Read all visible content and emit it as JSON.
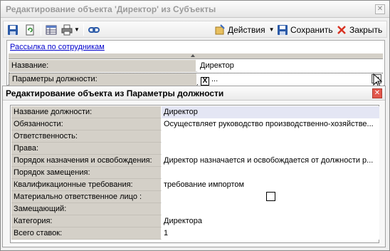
{
  "window": {
    "title": "Редактирование объекта 'Директор' из Субъекты",
    "close_glyph": "✕"
  },
  "toolbar": {
    "actions_label": "Действия",
    "save_label": "Сохранить",
    "close_label": "Закрыть"
  },
  "content": {
    "link_text": "Рассылка по сотрудникам",
    "properties": [
      {
        "label": "Название:",
        "value": "Директор"
      },
      {
        "label": "Параметры должности:",
        "value": "...",
        "x_glyph": "X",
        "button_glyph": "···"
      }
    ]
  },
  "dialog": {
    "title": "Редактирование объекта  из Параметры должности",
    "close_glyph": "✕",
    "rows": [
      {
        "label": "Название должности:",
        "value": "Директор"
      },
      {
        "label": "Обязанности:",
        "value": "Осуществляет руководство производственно-хозяйстве..."
      },
      {
        "label": "Ответственность:",
        "value": ""
      },
      {
        "label": "Права:",
        "value": ""
      },
      {
        "label": "Порядок назначения и освобождения:",
        "value": "Директор назначается и освобождается от должности  р..."
      },
      {
        "label": "Порядок замещения:",
        "value": ""
      },
      {
        "label": "Квалификационные требования:",
        "value": "требование импортом"
      },
      {
        "label": "Материально ответственное лицо :",
        "value": "",
        "checkbox": false
      },
      {
        "label": "Замещающий:",
        "value": ""
      },
      {
        "label": "Категория:",
        "value": "Директора"
      },
      {
        "label": "Всего ставок:",
        "value": "1"
      }
    ]
  },
  "colors": {
    "accent_link": "#0000cc",
    "close_red": "#e2574c",
    "label_bg": "#d4d0c8",
    "highlight_row": "#e4e6f4"
  },
  "icons": [
    "save-icon",
    "refresh-icon",
    "table-icon",
    "print-icon",
    "link-icon",
    "actions-icon",
    "save-icon",
    "close-x-icon"
  ]
}
